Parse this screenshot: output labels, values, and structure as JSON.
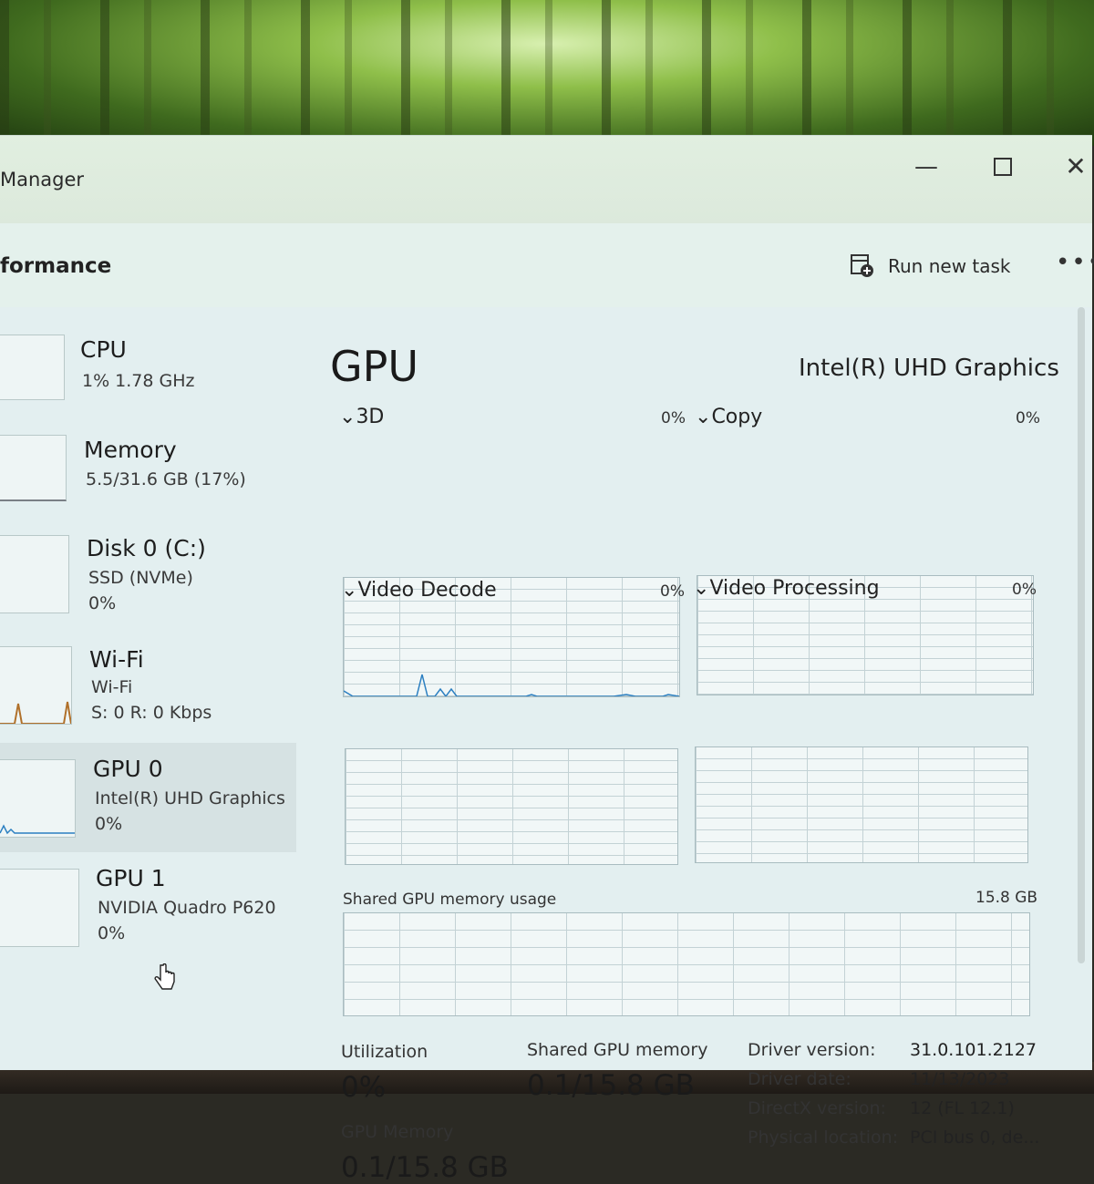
{
  "window": {
    "title": "Manager",
    "controls": {
      "minimize": "—",
      "close": "✕"
    }
  },
  "toolbar": {
    "heading": "formance",
    "run_new_task": "Run new task",
    "more": "•••"
  },
  "sidebar": {
    "cpu": {
      "name": "CPU",
      "sub": "1%  1.78 GHz"
    },
    "memory": {
      "name": "Memory",
      "sub": "5.5/31.6 GB (17%)"
    },
    "disk": {
      "name": "Disk 0 (C:)",
      "sub1": "SSD (NVMe)",
      "sub2": "0%"
    },
    "wifi": {
      "name": "Wi-Fi",
      "sub1": "Wi-Fi",
      "sub2": "S: 0 R: 0 Kbps"
    },
    "gpu0": {
      "name": "GPU 0",
      "sub1": "Intel(R) UHD Graphics",
      "sub2": "0%"
    },
    "gpu1": {
      "name": "GPU 1",
      "sub1": "NVIDIA Quadro P620",
      "sub2": "0%"
    }
  },
  "main": {
    "title": "GPU",
    "model": "Intel(R) UHD Graphics",
    "engines": [
      {
        "label": "3D",
        "pct": "0%"
      },
      {
        "label": "Copy",
        "pct": "0%"
      },
      {
        "label": "Video Decode",
        "pct": "0%"
      },
      {
        "label": "Video Processing",
        "pct": "0%"
      }
    ],
    "shared_memory": {
      "label": "Shared GPU memory usage",
      "max": "15.8 GB"
    },
    "stats": {
      "utilization_label": "Utilization",
      "utilization_value": "0%",
      "shared_label": "Shared GPU memory",
      "shared_value": "0.1/15.8 GB",
      "gpu_memory_label": "GPU Memory",
      "gpu_memory_value": "0.1/15.8 GB"
    },
    "info": {
      "driver_version_key": "Driver version:",
      "driver_version": "31.0.101.2127",
      "driver_date_key": "Driver date:",
      "driver_date": "11/13/2023",
      "directx_key": "DirectX version:",
      "directx": "12 (FL 12.1)",
      "location_key": "Physical location:",
      "location": "PCI bus 0, de..."
    }
  },
  "colors": {
    "graph_line": "#2b7fc1",
    "wifi_line": "#b0702a",
    "window_bg": "#e3eff0"
  }
}
